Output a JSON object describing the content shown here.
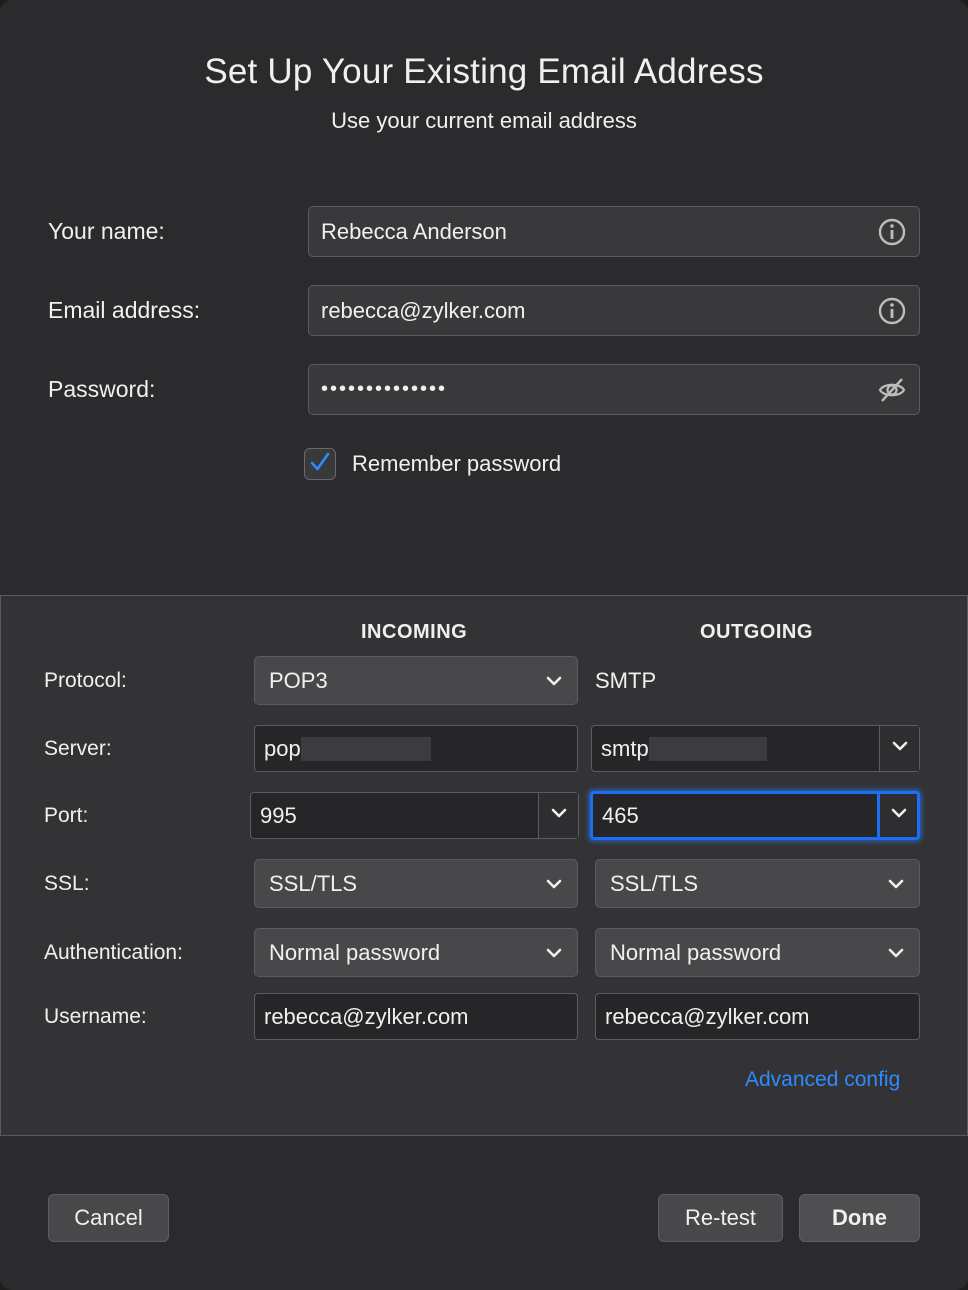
{
  "dialog": {
    "title": "Set Up Your Existing Email Address",
    "subtitle": "Use your current email address"
  },
  "identity": {
    "name_label": "Your name:",
    "name_value": "Rebecca Anderson",
    "email_label": "Email address:",
    "email_value": "rebecca@zylker.com",
    "password_label": "Password:",
    "password_value": "••••••••••••••",
    "remember_label": "Remember password",
    "remember_checked": true
  },
  "server_config": {
    "incoming_header": "INCOMING",
    "outgoing_header": "OUTGOING",
    "rows": {
      "protocol": {
        "label": "Protocol:",
        "incoming": "POP3",
        "outgoing": "SMTP"
      },
      "server": {
        "label": "Server:",
        "incoming": "pop",
        "outgoing": "smtp"
      },
      "port": {
        "label": "Port:",
        "incoming": "995",
        "outgoing": "465"
      },
      "ssl": {
        "label": "SSL:",
        "incoming": "SSL/TLS",
        "outgoing": "SSL/TLS"
      },
      "auth": {
        "label": "Authentication:",
        "incoming": "Normal password",
        "outgoing": "Normal password"
      },
      "username": {
        "label": "Username:",
        "incoming": "rebecca@zylker.com",
        "outgoing": "rebecca@zylker.com"
      }
    },
    "advanced_link": "Advanced config"
  },
  "footer": {
    "cancel_label": "Cancel",
    "retest_label": "Re-test",
    "done_label": "Done"
  },
  "colors": {
    "accent": "#1a6ff2",
    "link": "#2e8bff",
    "background": "#2b2b2d"
  },
  "icons": {
    "name_info": "info-icon",
    "email_info": "info-icon",
    "password_toggle": "eye-slash-icon",
    "checkbox": "checkmark-icon",
    "dropdown": "chevron-down-icon"
  }
}
